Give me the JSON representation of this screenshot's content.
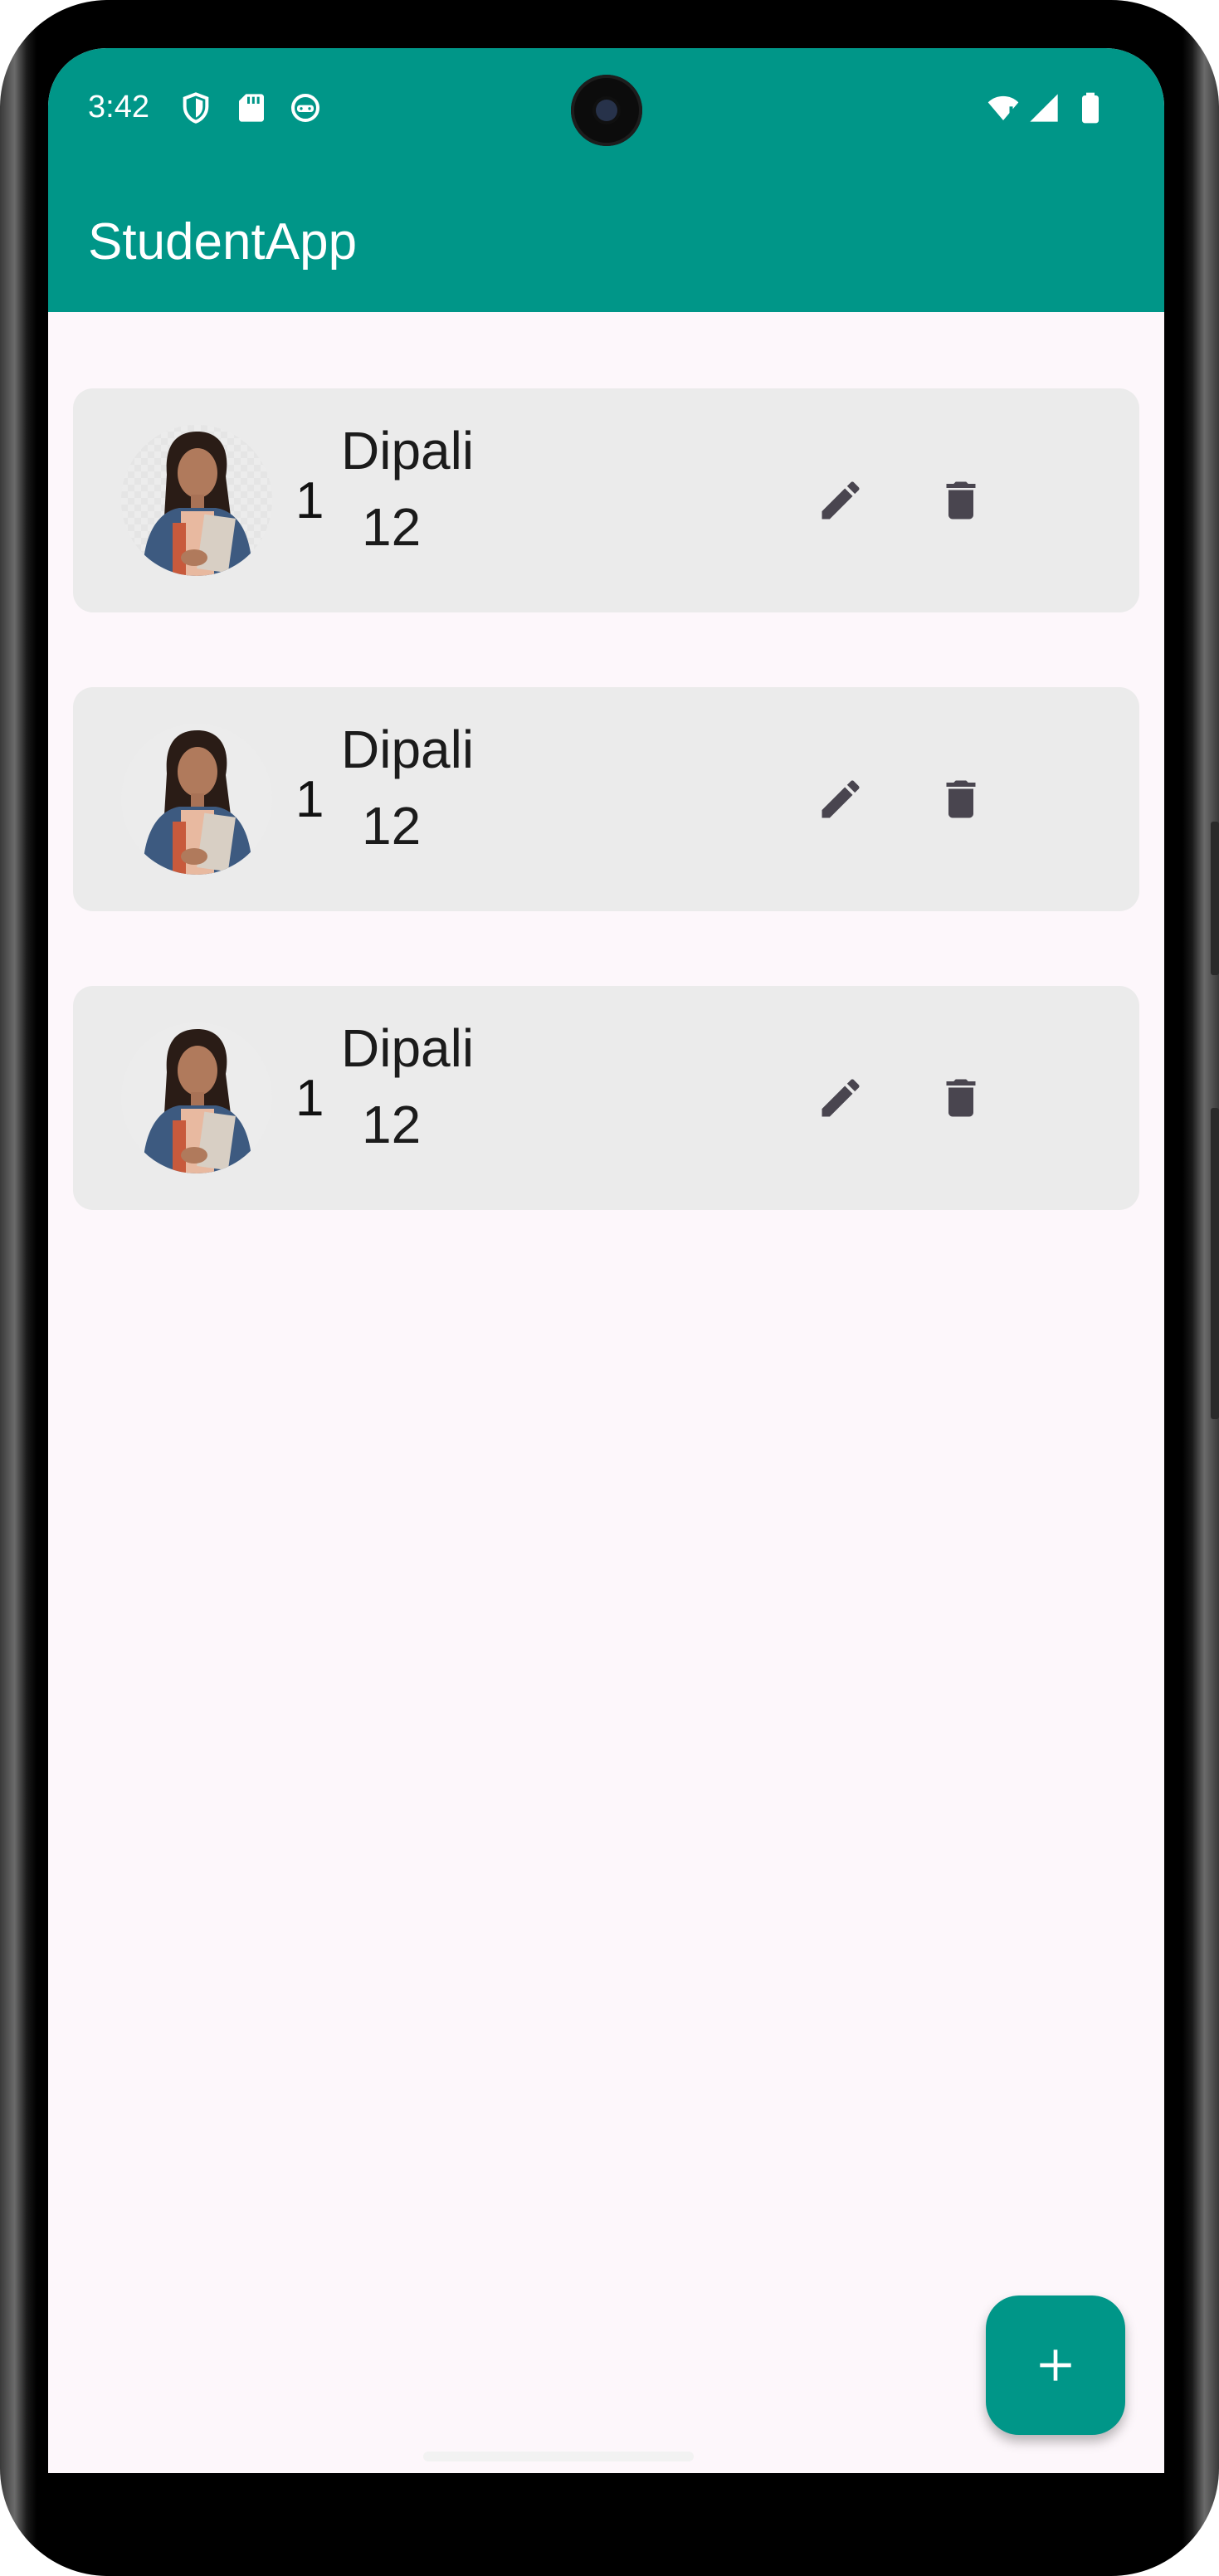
{
  "status_bar": {
    "time": "3:42",
    "left_icons": [
      "shield-icon",
      "sd-card-icon",
      "android-icon"
    ],
    "right_icons": [
      "wifi-icon",
      "signal-icon",
      "battery-icon"
    ]
  },
  "app_bar": {
    "title": "StudentApp",
    "color": "#009688"
  },
  "students": [
    {
      "roll": "1",
      "name": "Dipali",
      "class": "12"
    },
    {
      "roll": "1",
      "name": "Dipali",
      "class": "12"
    },
    {
      "roll": "1",
      "name": "Dipali",
      "class": "12"
    }
  ],
  "actions": {
    "edit_icon": "pencil-icon",
    "delete_icon": "trash-icon",
    "add_icon": "plus-icon"
  },
  "colors": {
    "accent": "#009688",
    "card": "#ebebeb",
    "background": "#fdf7fb",
    "icon": "#49454f"
  }
}
